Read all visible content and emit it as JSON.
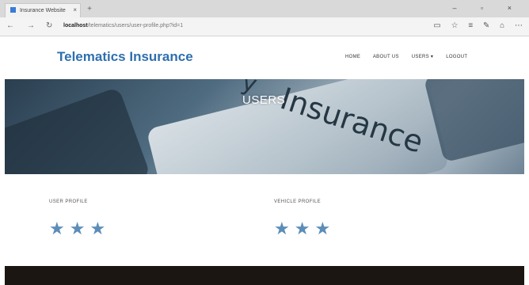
{
  "browser": {
    "tab_title": "Insurance Website",
    "tab_close": "×",
    "new_tab": "+",
    "window_controls": "–  ▫  ×",
    "url_host": "localhost",
    "url_path": "/telematics/users/user-profile.php?id=1",
    "back": "←",
    "forward": "→",
    "refresh": "↻",
    "right_icons": [
      "▭",
      "☆",
      "≡",
      "✎",
      "⌂",
      "⋯"
    ]
  },
  "site": {
    "logo": "Telematics Insurance",
    "nav": [
      "HOME",
      "ABOUT US",
      "USERS ▾",
      "LOGOUT"
    ]
  },
  "hero": {
    "title": "USERS",
    "key_text": "Insurance",
    "key_text_top": "y"
  },
  "sections": {
    "user_profile": {
      "title": "USER PROFILE",
      "stars": "★★★"
    },
    "vehicle_profile": {
      "title": "VEHICLE PROFILE",
      "stars": "★★★"
    }
  }
}
